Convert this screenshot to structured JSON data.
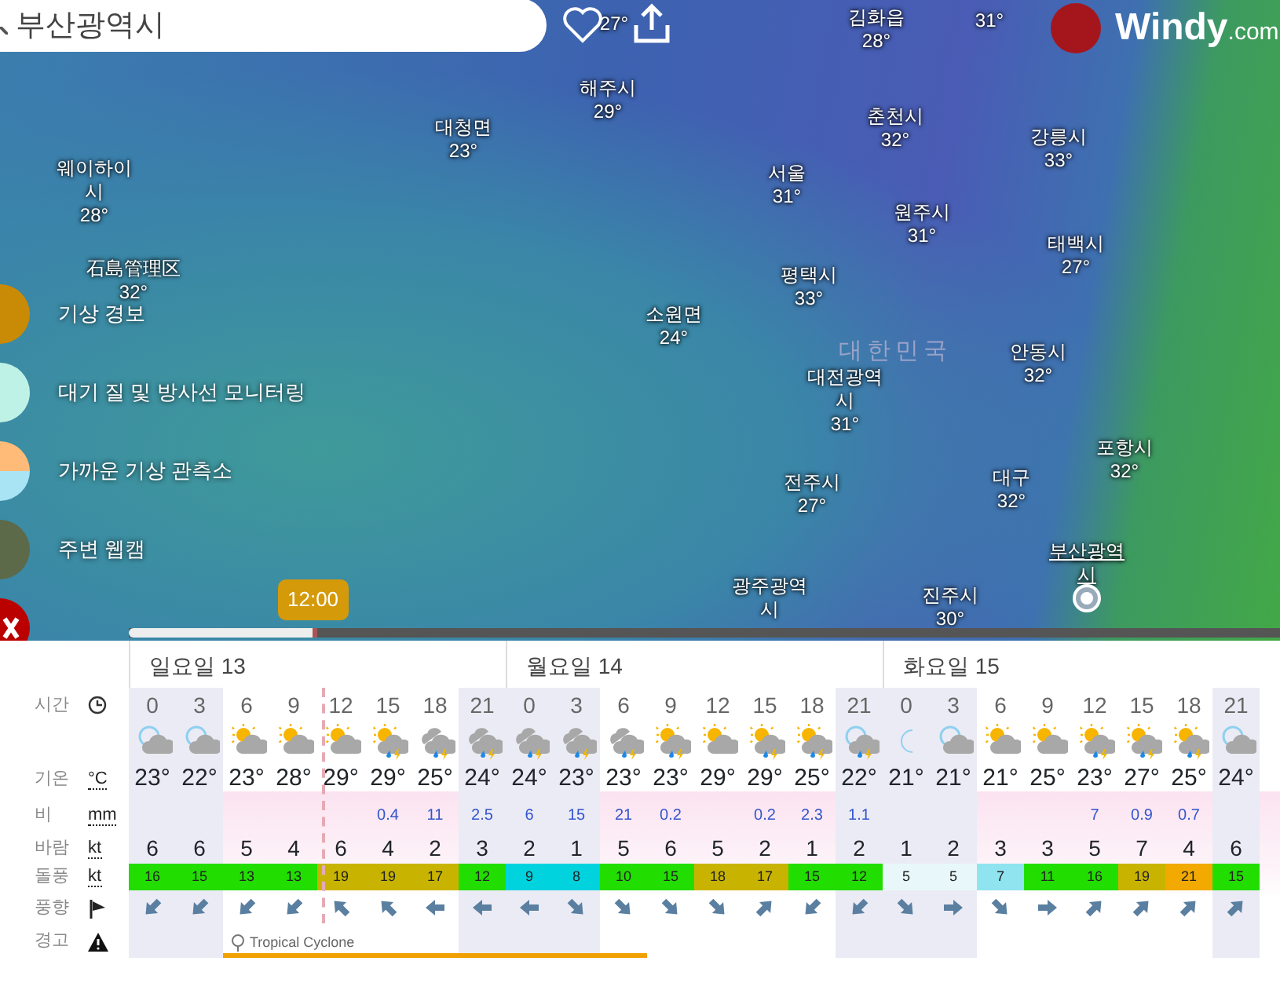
{
  "search": {
    "value": "부산광역시"
  },
  "map_labels": [
    {
      "kind": "city",
      "temp": "27°"
    },
    {
      "kind": "city",
      "name": "해주시",
      "temp": "29°"
    },
    {
      "kind": "city",
      "name": "대청면",
      "temp": "23°"
    },
    {
      "kind": "city",
      "name": "웨이하이시",
      "temp": "28°"
    },
    {
      "kind": "city",
      "name": "石島管理区",
      "temp": "32°"
    },
    {
      "kind": "city",
      "name": "김화읍",
      "temp": "28°"
    },
    {
      "kind": "city",
      "temp": "31°"
    },
    {
      "kind": "city",
      "name": "춘천시",
      "temp": "32°"
    },
    {
      "kind": "city",
      "name": "강릉시",
      "temp": "33°"
    },
    {
      "kind": "city",
      "name": "서울",
      "temp": "31°"
    },
    {
      "kind": "city",
      "name": "원주시",
      "temp": "31°"
    },
    {
      "kind": "city",
      "name": "태백시",
      "temp": "27°"
    },
    {
      "kind": "city",
      "name": "평택시",
      "temp": "33°"
    },
    {
      "kind": "city",
      "name": "소원면",
      "temp": "24°"
    },
    {
      "kind": "country",
      "name": "대한민국"
    },
    {
      "kind": "city",
      "name": "안동시",
      "temp": "32°"
    },
    {
      "kind": "city",
      "name": "대전광역시",
      "temp": "31°"
    },
    {
      "kind": "city",
      "name": "포항시",
      "temp": "32°"
    },
    {
      "kind": "city",
      "name": "전주시",
      "temp": "27°"
    },
    {
      "kind": "city",
      "name": "대구",
      "temp": "32°"
    },
    {
      "kind": "current",
      "name": "부산광역시"
    },
    {
      "kind": "city",
      "name": "광주광역시"
    },
    {
      "kind": "city",
      "name": "진주시",
      "temp": "30°"
    }
  ],
  "logo": {
    "name": "Windy",
    "suffix": ".com"
  },
  "sidebar": [
    {
      "kind": "alerts",
      "label": "기상 경보"
    },
    {
      "kind": "air",
      "label": "대기 질 및 방사선 모니터링"
    },
    {
      "kind": "station",
      "label": "가까운 기상 관측소"
    },
    {
      "kind": "webcam",
      "label": "주변 웹캠"
    }
  ],
  "timeline": {
    "time": "12:00",
    "level": 0.164
  },
  "forecast": {
    "row_labels": [
      {
        "label": "시간",
        "kind": "clock"
      },
      {
        "label": "기온",
        "unit": "°C"
      },
      {
        "label": "비",
        "unit": "mm"
      },
      {
        "label": "바람",
        "unit": "kt"
      },
      {
        "label": "돌풍",
        "unit": "kt"
      },
      {
        "label": "풍향",
        "kind": "flag"
      },
      {
        "label": "경고",
        "kind": "warning"
      }
    ],
    "warning_label": "Tropical Cyclone",
    "days": [
      {
        "label": "일요일 13",
        "columns": [
          {
            "hour": "0",
            "kind": "night-cloud",
            "temp": "23°",
            "wind": "6",
            "gust": "16",
            "wind_arrow": {
              "kind": "sw"
            },
            "night": true,
            "now": false,
            "warning": false
          },
          {
            "hour": "3",
            "kind": "night-cloud",
            "temp": "22°",
            "wind": "6",
            "gust": "15",
            "wind_arrow": {
              "kind": "sw"
            },
            "night": true,
            "now": false,
            "warning": false
          },
          {
            "hour": "6",
            "kind": "sun-cloud",
            "temp": "23°",
            "wind": "5",
            "gust": "13",
            "wind_arrow": {
              "kind": "sw"
            },
            "night": false,
            "now": false,
            "warning": true
          },
          {
            "hour": "9",
            "kind": "sun-cloud",
            "temp": "28°",
            "wind": "4",
            "gust": "13",
            "wind_arrow": {
              "kind": "sw"
            },
            "night": false,
            "now": false,
            "warning": true
          },
          {
            "hour": "12",
            "kind": "sun-cloud",
            "temp": "29°",
            "wind": "6",
            "gust": "19",
            "wind_arrow": {
              "kind": "nw"
            },
            "night": false,
            "now": true,
            "warning": true
          },
          {
            "hour": "15",
            "kind": "sun-rain",
            "temp": "29°",
            "rain": "0.4",
            "wind": "4",
            "gust": "19",
            "wind_arrow": {
              "kind": "nw"
            },
            "night": false,
            "now": false,
            "warning": true
          },
          {
            "hour": "18",
            "kind": "cloud-rain",
            "temp": "25°",
            "rain": "11",
            "wind": "2",
            "gust": "17",
            "wind_arrow": {
              "kind": "w"
            },
            "night": false,
            "now": false,
            "warning": true
          },
          {
            "hour": "21",
            "kind": "cloud-rain",
            "temp": "24°",
            "rain": "2.5",
            "wind": "3",
            "gust": "12",
            "wind_arrow": {
              "kind": "w"
            },
            "night": true,
            "now": false,
            "warning": true
          }
        ]
      },
      {
        "label": "월요일 14",
        "columns": [
          {
            "hour": "0",
            "kind": "cloud-rain",
            "temp": "24°",
            "rain": "6",
            "wind": "2",
            "gust": "9",
            "wind_arrow": {
              "kind": "w"
            },
            "night": true,
            "now": false,
            "warning": true
          },
          {
            "hour": "3",
            "kind": "cloud-rain",
            "temp": "23°",
            "rain": "15",
            "wind": "1",
            "gust": "8",
            "wind_arrow": {
              "kind": "se"
            },
            "night": true,
            "now": false,
            "warning": true
          },
          {
            "hour": "6",
            "kind": "cloud-rain",
            "temp": "23°",
            "rain": "21",
            "wind": "5",
            "gust": "10",
            "wind_arrow": {
              "kind": "se"
            },
            "night": false,
            "now": false,
            "warning": true
          },
          {
            "hour": "9",
            "kind": "sun-rain",
            "temp": "23°",
            "rain": "0.2",
            "wind": "6",
            "gust": "15",
            "wind_arrow": {
              "kind": "se"
            },
            "night": false,
            "now": false,
            "warning": false
          },
          {
            "hour": "12",
            "kind": "sun-cloud",
            "temp": "29°",
            "wind": "5",
            "gust": "18",
            "wind_arrow": {
              "kind": "se"
            },
            "night": false,
            "now": false,
            "warning": false
          },
          {
            "hour": "15",
            "kind": "sun-rain",
            "temp": "29°",
            "rain": "0.2",
            "wind": "2",
            "gust": "17",
            "wind_arrow": {
              "kind": "ne"
            },
            "night": false,
            "now": false,
            "warning": false
          },
          {
            "hour": "18",
            "kind": "sun-rain",
            "temp": "25°",
            "rain": "2.3",
            "wind": "1",
            "gust": "15",
            "wind_arrow": {
              "kind": "sw"
            },
            "night": false,
            "now": false,
            "warning": false
          },
          {
            "hour": "21",
            "kind": "night-rain",
            "temp": "22°",
            "rain": "1.1",
            "wind": "2",
            "gust": "12",
            "wind_arrow": {
              "kind": "sw"
            },
            "night": true,
            "now": false,
            "warning": false
          }
        ]
      },
      {
        "label": "화요일 15",
        "columns": [
          {
            "hour": "0",
            "kind": "moon",
            "temp": "21°",
            "wind": "1",
            "gust": "5",
            "wind_arrow": {
              "kind": "se"
            },
            "night": true,
            "now": false,
            "warning": false
          },
          {
            "hour": "3",
            "kind": "night-cloud",
            "temp": "21°",
            "wind": "2",
            "gust": "5",
            "wind_arrow": {
              "kind": "e"
            },
            "night": true,
            "now": false,
            "warning": false
          },
          {
            "hour": "6",
            "kind": "sun-cloud",
            "temp": "21°",
            "wind": "3",
            "gust": "7",
            "wind_arrow": {
              "kind": "se"
            },
            "night": false,
            "now": false,
            "warning": false
          },
          {
            "hour": "9",
            "kind": "sun-cloud",
            "temp": "25°",
            "wind": "3",
            "gust": "11",
            "wind_arrow": {
              "kind": "e"
            },
            "night": false,
            "now": false,
            "warning": false
          },
          {
            "hour": "12",
            "kind": "sun-rain",
            "temp": "23°",
            "rain": "7",
            "wind": "5",
            "gust": "16",
            "wind_arrow": {
              "kind": "ne"
            },
            "night": false,
            "now": false,
            "warning": false
          },
          {
            "hour": "15",
            "kind": "sun-rain",
            "temp": "27°",
            "rain": "0.9",
            "wind": "7",
            "gust": "19",
            "wind_arrow": {
              "kind": "ne"
            },
            "night": false,
            "now": false,
            "warning": false
          },
          {
            "hour": "18",
            "kind": "sun-rain",
            "temp": "25°",
            "rain": "0.7",
            "wind": "4",
            "gust": "21",
            "wind_arrow": {
              "kind": "ne"
            },
            "night": false,
            "now": false,
            "warning": false
          },
          {
            "hour": "21",
            "kind": "night-cloud",
            "temp": "24°",
            "wind": "6",
            "gust": "15",
            "wind_arrow": {
              "kind": "ne"
            },
            "night": true,
            "now": false,
            "warning": false
          }
        ]
      }
    ]
  }
}
